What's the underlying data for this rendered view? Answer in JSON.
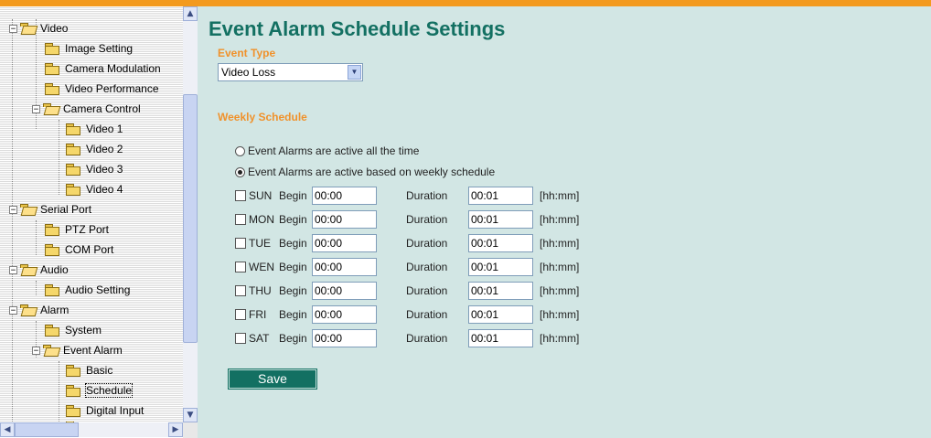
{
  "page": {
    "title": "Event Alarm Schedule Settings"
  },
  "event_type": {
    "label": "Event Type",
    "selected": "Video Loss"
  },
  "weekly": {
    "label": "Weekly Schedule",
    "option_all": "Event Alarms are active all the time",
    "option_weekly": "Event Alarms are active based on weekly schedule",
    "selected_option": "weekly",
    "begin_label": "Begin",
    "duration_label": "Duration",
    "unit_label": "[hh:mm]",
    "days": [
      {
        "day": "SUN",
        "begin": "00:00",
        "duration": "00:01",
        "checked": false
      },
      {
        "day": "MON",
        "begin": "00:00",
        "duration": "00:01",
        "checked": false
      },
      {
        "day": "TUE",
        "begin": "00:00",
        "duration": "00:01",
        "checked": false
      },
      {
        "day": "WEN",
        "begin": "00:00",
        "duration": "00:01",
        "checked": false
      },
      {
        "day": "THU",
        "begin": "00:00",
        "duration": "00:01",
        "checked": false
      },
      {
        "day": "FRI",
        "begin": "00:00",
        "duration": "00:01",
        "checked": false
      },
      {
        "day": "SAT",
        "begin": "00:00",
        "duration": "00:01",
        "checked": false
      }
    ]
  },
  "save_label": "Save",
  "tree": {
    "items": [
      {
        "label": "Video",
        "icon": "folder-open-icon"
      },
      {
        "label": "Image Setting",
        "icon": "folder-icon"
      },
      {
        "label": "Camera Modulation",
        "icon": "folder-icon"
      },
      {
        "label": "Video Performance",
        "icon": "folder-icon"
      },
      {
        "label": "Camera Control",
        "icon": "folder-open-icon"
      },
      {
        "label": "Video 1",
        "icon": "folder-icon"
      },
      {
        "label": "Video 2",
        "icon": "folder-icon"
      },
      {
        "label": "Video 3",
        "icon": "folder-icon"
      },
      {
        "label": "Video 4",
        "icon": "folder-icon"
      },
      {
        "label": "Serial Port",
        "icon": "folder-open-icon"
      },
      {
        "label": "PTZ Port",
        "icon": "folder-icon"
      },
      {
        "label": "COM Port",
        "icon": "folder-icon"
      },
      {
        "label": "Audio",
        "icon": "folder-open-icon"
      },
      {
        "label": "Audio Setting",
        "icon": "folder-icon"
      },
      {
        "label": "Alarm",
        "icon": "folder-open-icon"
      },
      {
        "label": "System",
        "icon": "folder-icon"
      },
      {
        "label": "Event Alarm",
        "icon": "folder-open-icon"
      },
      {
        "label": "Basic",
        "icon": "folder-icon"
      },
      {
        "label": "Schedule",
        "icon": "folder-icon",
        "selected": true
      },
      {
        "label": "Digital Input",
        "icon": "folder-icon"
      }
    ]
  },
  "colors": {
    "accent_bar": "#f39a1e",
    "title": "#137062",
    "section": "#f0922c",
    "panel_bg": "#d2e6e4"
  }
}
